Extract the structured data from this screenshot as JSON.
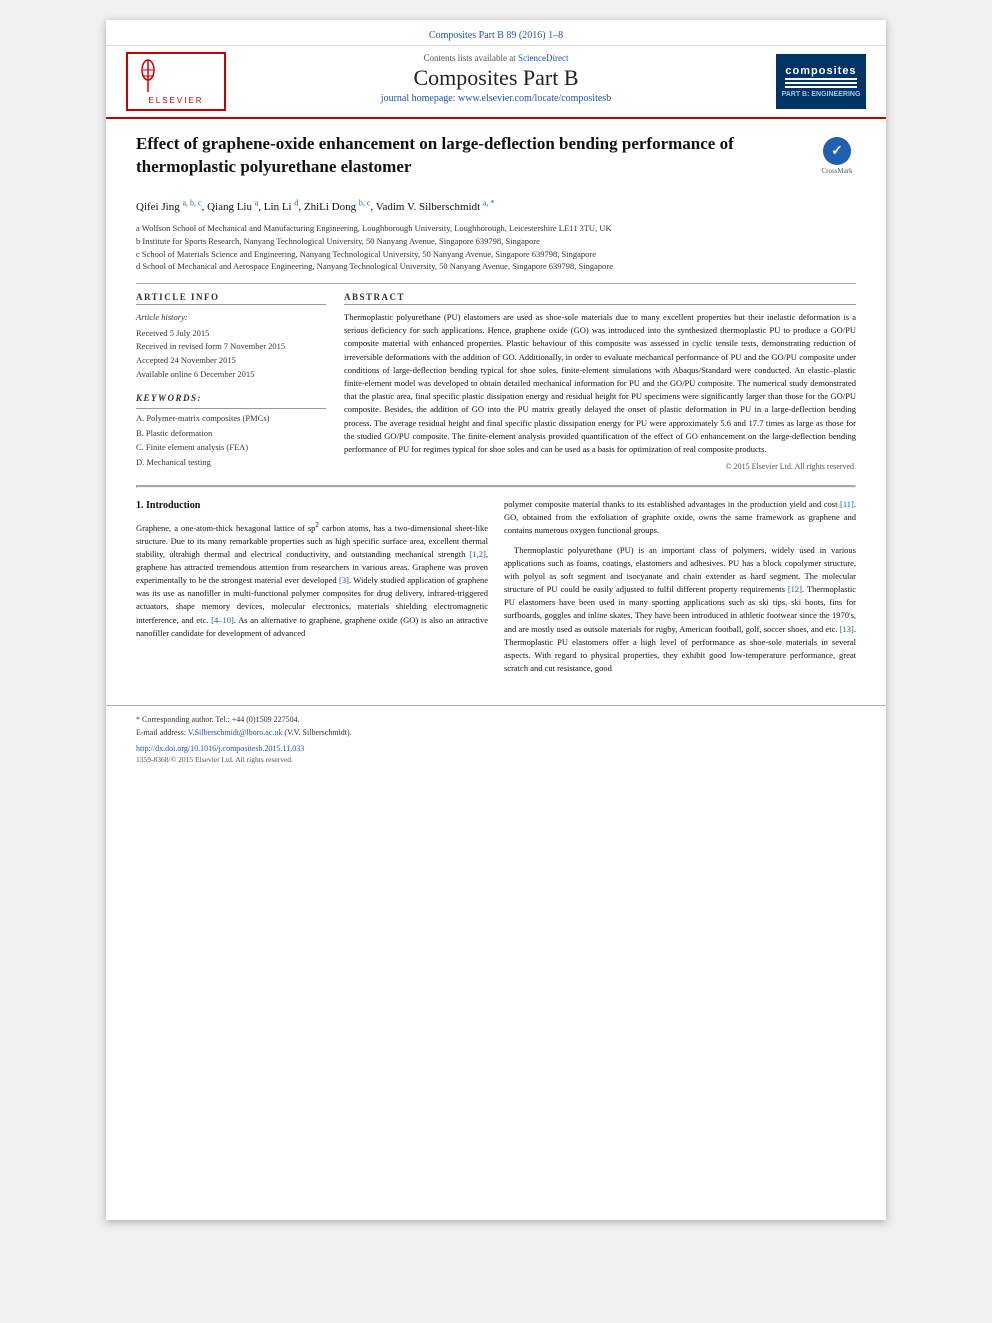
{
  "journal": {
    "top_link": "Composites Part B 89 (2016) 1–8",
    "contents_text": "Contents lists available at",
    "science_direct": "ScienceDirect",
    "title": "Composites Part B",
    "homepage_text": "journal homepage:",
    "homepage_url": "www.elsevier.com/locate/compositesb",
    "elsevier_text": "ELSEVIER"
  },
  "article": {
    "title": "Effect of graphene-oxide enhancement on large-deflection bending performance of thermoplastic polyurethane elastomer",
    "crossmark_label": "CrossMark"
  },
  "authors": {
    "list": "Qifei Jing a, b, c, Qiang Liu a, Lin Li d, ZhiLi Dong b, c, Vadim V. Silberschmidt a, *"
  },
  "affiliations": {
    "a": "a Wolfson School of Mechanical and Manufacturing Engineering, Loughborough University, Loughborough, Leicestershire LE11 3TU, UK",
    "b": "b Institute for Sports Research, Nanyang Technological University, 50 Nanyang Avenue, Singapore 639798, Singapore",
    "c": "c School of Materials Science and Engineering, Nanyang Technological University, 50 Nanyang Avenue, Singapore 639798, Singapore",
    "d": "d School of Mechanical and Aerospace Engineering, Nanyang Technological University, 50 Nanyang Avenue, Singapore 639798, Singapore"
  },
  "article_info": {
    "heading": "Article Info",
    "history_label": "Article history:",
    "received": "Received 5 July 2015",
    "revised": "Received in revised form 7 November 2015",
    "accepted": "Accepted 24 November 2015",
    "available": "Available online 6 December 2015"
  },
  "keywords": {
    "heading": "Keywords:",
    "items": [
      "A. Polymer-matrix composites (PMCs)",
      "B. Plastic deformation",
      "C. Finite element analysis (FEA)",
      "D. Mechanical testing"
    ]
  },
  "abstract": {
    "heading": "Abstract",
    "text": "Thermoplastic polyurethane (PU) elastomers are used as shoe-sole materials due to many excellent properties but their inelastic deformation is a serious deficiency for such applications. Hence, graphene oxide (GO) was introduced into the synthesized thermoplastic PU to produce a GO/PU composite material with enhanced properties. Plastic behaviour of this composite was assessed in cyclic tensile tests, demonstrating reduction of irreversible deformations with the addition of GO. Additionally, in order to evaluate mechanical performance of PU and the GO/PU composite under conditions of large-deflection bending typical for shoe soles, finite-element simulations with Abaqus/Standard were conducted. An elastic–plastic finite-element model was developed to obtain detailed mechanical information for PU and the GO/PU composite. The numerical study demonstrated that the plastic area, final specific plastic dissipation energy and residual height for PU specimens were significantly larger than those for the GO/PU composite. Besides, the addition of GO into the PU matrix greatly delayed the onset of plastic deformation in PU in a large-deflection bending process. The average residual height and final specific plastic dissipation energy for PU were approximately 5.6 and 17.7 times as large as those for the studied GO/PU composite. The finite-element analysis provided quantification of the effect of GO enhancement on the large-deflection bending performance of PU for regimes typical for shoe soles and can be used as a basis for optimization of real composite products.",
    "copyright": "© 2015 Elsevier Ltd. All rights reserved."
  },
  "intro": {
    "section_number": "1.",
    "section_title": "Introduction",
    "col1_paragraphs": [
      "Graphene, a one-atom-thick hexagonal lattice of sp² carbon atoms, has a two-dimensional sheet-like structure. Due to its many remarkable properties such as high specific surface area, excellent thermal stability, ultrahigh thermal and electrical conductivity, and outstanding mechanical strength [1,2], graphene has attracted tremendous attention from researchers in various areas. Graphene was proven experimentally to be the strongest material ever developed [3]. Widely studied application of graphene was its use as nanofiller in multi-functional polymer composites for drug delivery, infrared-triggered actuators, shape memory devices, molecular electronics, materials shielding electromagnetic interference, and etc. [4–10]. As an alternative to graphene, graphene oxide (GO) is also an attractive nanofiller candidate for development of advanced"
    ],
    "col2_paragraphs": [
      "polymer composite material thanks to its established advantages in the production yield and cost [11]. GO, obtained from the exfoliation of graphite oxide, owns the same framework as graphene and contains numerous oxygen functional groups.",
      "Thermoplastic polyurethane (PU) is an important class of polymers, widely used in various applications such as foams, coatings, elastomers and adhesives. PU has a block copolymer structure, with polyol as soft segment and isocyanate and chain extender as hard segment. The molecular structure of PU could be easily adjusted to fulfil different property requirements [12]. Thermoplastic PU elastomers have been used in many sporting applications such as ski tips, ski boots, fins for surfboards, goggles and inline skates. They have been introduced in athletic footwear since the 1970's, and are mostly used as outsole materials for rugby, American football, golf, soccer shoes, and etc. [13]. Thermoplastic PU elastomers offer a high level of performance as shoe-sole materials in several aspects. With regard to physical properties, they exhibit good low-temperature performance, great scratch and cut resistance, good"
    ]
  },
  "footer": {
    "corresponding": "* Corresponding author. Tel.: +44 (0)1509 227504.",
    "email_label": "E-mail address:",
    "email": "V.Silberschmidt@lboro.ac.uk",
    "email_name": "(V.V. Silberschmidt).",
    "doi": "http://dx.doi.org/10.1016/j.compositesb.2015.11.033",
    "issn": "1359-8368/© 2015 Elsevier Ltd. All rights reserved."
  }
}
